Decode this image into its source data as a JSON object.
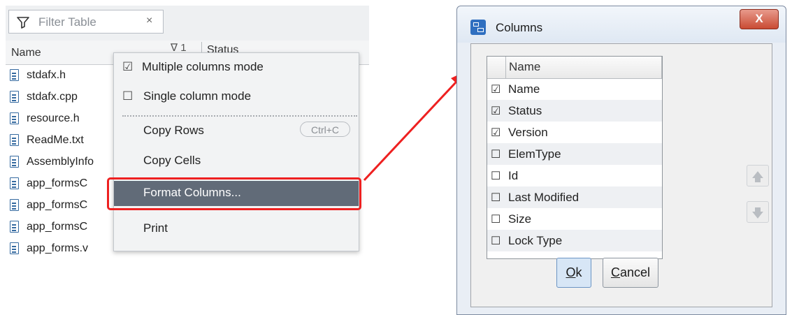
{
  "filter": {
    "placeholder": "Filter Table",
    "clear_glyph": "×"
  },
  "table": {
    "header_name": "Name",
    "header_sort": "∇ 1",
    "header_status": "Status",
    "rows": [
      "stdafx.h",
      "stdafx.cpp",
      "resource.h",
      "ReadMe.txt",
      "AssemblyInfo",
      "app_formsC",
      "app_formsC",
      "app_formsC",
      "app_forms.v"
    ]
  },
  "context_menu": {
    "check_checked": "☑",
    "check_unchecked": "☐",
    "multiple_columns_mode": "Multiple columns mode",
    "single_column_mode": "Single column mode",
    "copy_rows": "Copy Rows",
    "copy_rows_shortcut": "Ctrl+C",
    "copy_cells": "Copy Cells",
    "format_columns": "Format Columns...",
    "print": "Print"
  },
  "dialog": {
    "title": "Columns",
    "close_glyph": "X",
    "list_header": "Name",
    "columns": [
      {
        "label": "Name",
        "mark": "☑",
        "checked": true
      },
      {
        "label": "Status",
        "mark": "☑",
        "checked": true
      },
      {
        "label": "Version",
        "mark": "☑",
        "checked": true
      },
      {
        "label": "ElemType",
        "mark": "☐",
        "checked": false
      },
      {
        "label": "Id",
        "mark": "☐",
        "checked": false
      },
      {
        "label": "Last Modified",
        "mark": "☐",
        "checked": false
      },
      {
        "label": "Size",
        "mark": "☐",
        "checked": false
      },
      {
        "label": "Lock Type",
        "mark": "☐",
        "checked": false
      }
    ],
    "move_up_glyph": "🡅",
    "move_down_glyph": "🡇",
    "ok_mnemonic": "O",
    "ok_rest": "k",
    "cancel_mnemonic": "C",
    "cancel_rest": "ancel"
  },
  "colors": {
    "highlight": "#ee2020",
    "selected_item_bg": "#616b78",
    "file_icon": "#356aa0"
  }
}
